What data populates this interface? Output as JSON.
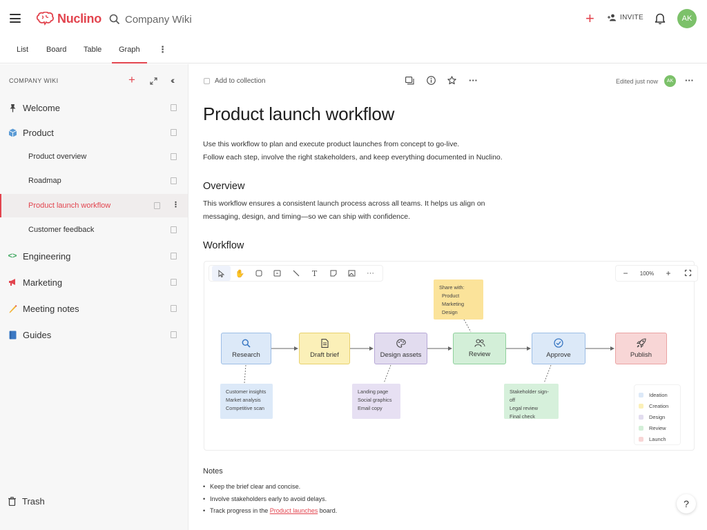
{
  "app": {
    "logo_text": "Nuclino",
    "search_text": "Company Wiki",
    "invite_label": "INVITE",
    "avatar_initials": "AK",
    "accent_color": "#e2444e"
  },
  "tabs": [
    {
      "label": "List"
    },
    {
      "label": "Board"
    },
    {
      "label": "Table"
    },
    {
      "label": "Graph",
      "active": true
    }
  ],
  "sidebar": {
    "header": "COMPANY WIKI",
    "items": [
      {
        "label": "Welcome",
        "icon": "pin-icon"
      },
      {
        "label": "Product",
        "icon": "cube-icon"
      },
      {
        "label": "Product overview",
        "child": true
      },
      {
        "label": "Roadmap",
        "child": true
      },
      {
        "label": "Product launch workflow",
        "child": true,
        "active": true
      },
      {
        "label": "Customer feedback",
        "child": true
      },
      {
        "label": "Engineering",
        "icon": "code-icon"
      },
      {
        "label": "Marketing",
        "icon": "megaphone-icon"
      },
      {
        "label": "Meeting notes",
        "icon": "pencil-icon"
      },
      {
        "label": "Guides",
        "icon": "book-icon"
      }
    ],
    "trash_label": "Trash"
  },
  "doc": {
    "add_to_collection": "Add to collection",
    "edited": "Edited just now",
    "avatar_initials": "AK",
    "title": "Product launch workflow",
    "intro_line1": "Use this workflow to plan and execute product launches from concept to go-live.",
    "intro_line2": "Follow each step, involve the right stakeholders, and keep everything documented in Nuclino.",
    "overview_heading": "Overview",
    "overview_line1": "This workflow ensures a consistent launch process across all teams. It helps us align on",
    "overview_line2": "messaging, design, and timing—so we can ship with confidence.",
    "workflow_heading": "Workflow",
    "notes_heading": "Notes",
    "notes": [
      "Keep the brief clear and concise.",
      "Involve stakeholders early to avoid delays."
    ],
    "note3_prefix": "Track progress in the ",
    "note3_link": "Product launches",
    "note3_suffix": " board."
  },
  "board": {
    "zoom": "100%",
    "nodes": [
      {
        "label": "Research",
        "icon": "search-icon"
      },
      {
        "label": "Draft brief",
        "icon": "document-icon"
      },
      {
        "label": "Design assets",
        "icon": "palette-icon"
      },
      {
        "label": "Review",
        "icon": "people-icon"
      },
      {
        "label": "Approve",
        "icon": "check-circle-icon"
      },
      {
        "label": "Publish",
        "icon": "rocket-icon"
      }
    ],
    "sticky_share": {
      "heading": "Share with:",
      "items": [
        "Product",
        "Marketing",
        "Design"
      ]
    },
    "sticky_research": [
      "Customer insights",
      "Market analysis",
      "Competitive scan"
    ],
    "sticky_design": [
      "Landing page",
      "Social graphics",
      "Email copy"
    ],
    "sticky_approve": [
      "Stakeholder sign-off",
      "Legal review",
      "Final check"
    ],
    "legend": [
      {
        "label": "Ideation",
        "color": "#dce9f8"
      },
      {
        "label": "Creation",
        "color": "#fbf0b8"
      },
      {
        "label": "Design",
        "color": "#e2dcef"
      },
      {
        "label": "Review",
        "color": "#d3efd8"
      },
      {
        "label": "Launch",
        "color": "#f8d6d6"
      }
    ]
  },
  "help_label": "?"
}
